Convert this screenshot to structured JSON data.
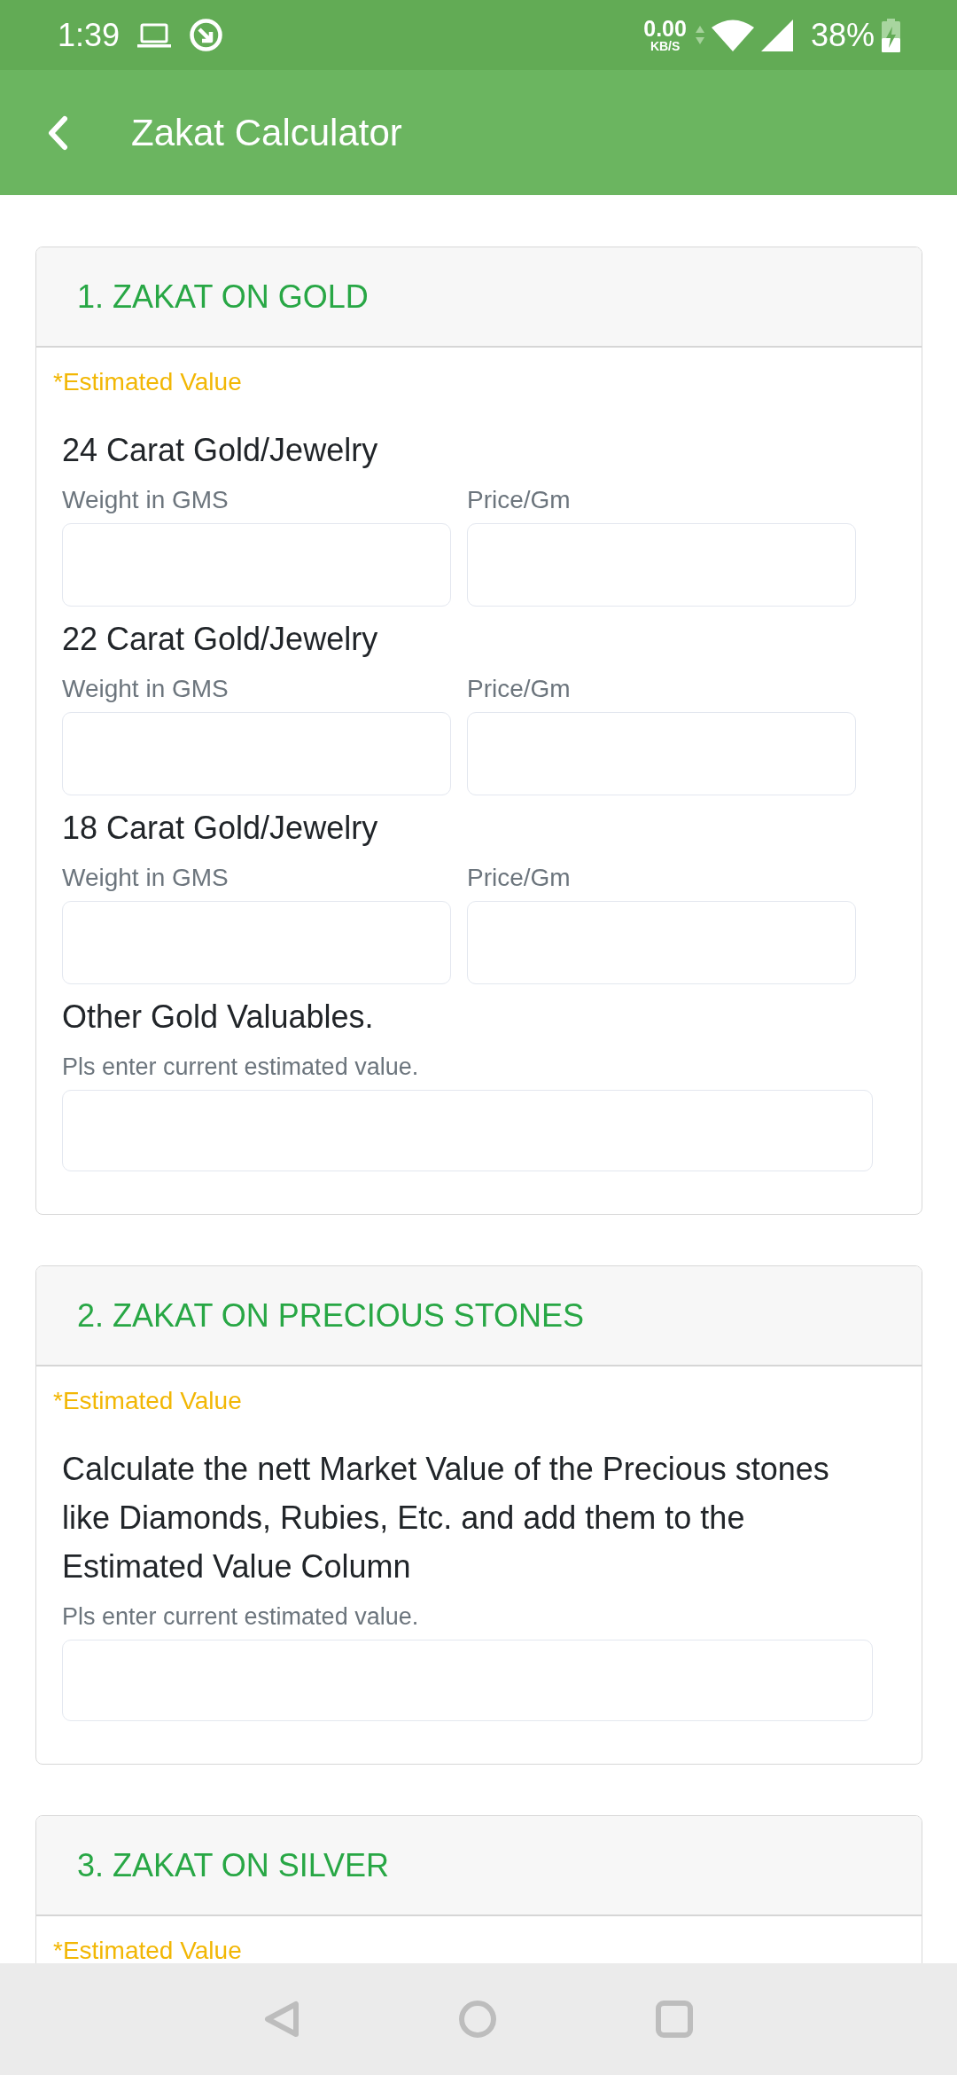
{
  "status_bar": {
    "time": "1:39",
    "net_speed": "0.00",
    "net_unit": "KB/S",
    "battery": "38%"
  },
  "app_bar": {
    "title": "Zakat Calculator"
  },
  "sections": [
    {
      "title": "1. ZAKAT ON GOLD",
      "note": "*Estimated Value",
      "items": [
        {
          "kind": "pair",
          "label": "24 Carat Gold/Jewelry",
          "fields": [
            {
              "caption": "Weight in GMS"
            },
            {
              "caption": "Price/Gm"
            }
          ]
        },
        {
          "kind": "pair",
          "label": "22 Carat Gold/Jewelry",
          "fields": [
            {
              "caption": "Weight in GMS"
            },
            {
              "caption": "Price/Gm"
            }
          ]
        },
        {
          "kind": "pair",
          "label": "18 Carat Gold/Jewelry",
          "fields": [
            {
              "caption": "Weight in GMS"
            },
            {
              "caption": "Price/Gm"
            }
          ]
        },
        {
          "kind": "single",
          "label": "Other Gold Valuables.",
          "caption": "Pls enter current estimated value."
        }
      ]
    },
    {
      "title": "2. ZAKAT ON PRECIOUS STONES",
      "note": "*Estimated Value",
      "items": [
        {
          "kind": "single",
          "label": "Calculate the nett Market Value of the Precious stones like Diamonds, Rubies, Etc. and add them to the Estimated Value Column",
          "caption": "Pls enter current estimated value."
        }
      ]
    },
    {
      "title": "3. ZAKAT ON SILVER",
      "note": "*Estimated Value"
    }
  ]
}
